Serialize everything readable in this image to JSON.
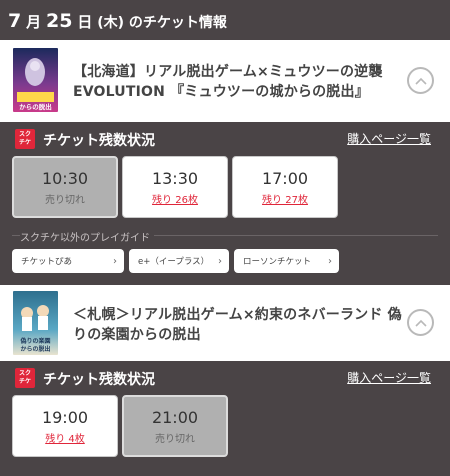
{
  "header": {
    "month": "7",
    "month_unit": "月",
    "day": "25",
    "day_unit": "日",
    "weekday": "(木)",
    "suffix": "のチケット情報"
  },
  "events": [
    {
      "title": "【北海道】リアル脱出ゲーム×ミュウツーの逆襲 EVOLUTION 『ミュウツーの城からの脱出』",
      "poster_text": "からの脱出",
      "poster_colors": [
        "#1c2a5c",
        "#7a3a8e",
        "#c93a8a"
      ],
      "status_label": "チケット残数状況",
      "buy_link": "購入ページ一覧",
      "slots": [
        {
          "time": "10:30",
          "remain": "売り切れ",
          "soldout": true
        },
        {
          "time": "13:30",
          "remain": "残り 26枚",
          "soldout": false
        },
        {
          "time": "17:00",
          "remain": "残り 27枚",
          "soldout": false
        }
      ],
      "guide_label": "スクチケ以外のプレイガイド",
      "guides": [
        "チケットぴあ",
        "e+（イープラス）",
        "ローソンチケット"
      ]
    },
    {
      "title": "＜札幌＞リアル脱出ゲーム×約束のネバーランド 偽りの楽園からの脱出",
      "poster_text": "偽りの楽園からの脱出",
      "poster_colors": [
        "#2e6f8e",
        "#59a7c4",
        "#e8e3cf"
      ],
      "status_label": "チケット残数状況",
      "buy_link": "購入ページ一覧",
      "slots": [
        {
          "time": "19:00",
          "remain": "残り 4枚",
          "soldout": false
        },
        {
          "time": "21:00",
          "remain": "売り切れ",
          "soldout": true
        }
      ]
    }
  ],
  "brand": {
    "logo_top": "スク",
    "logo_bottom": "チケ",
    "accent": "#e0263a",
    "background": "#4a4446"
  },
  "icons": {
    "toggle": "chevron-up-icon",
    "guide_arrow": "chevron-right-icon"
  }
}
